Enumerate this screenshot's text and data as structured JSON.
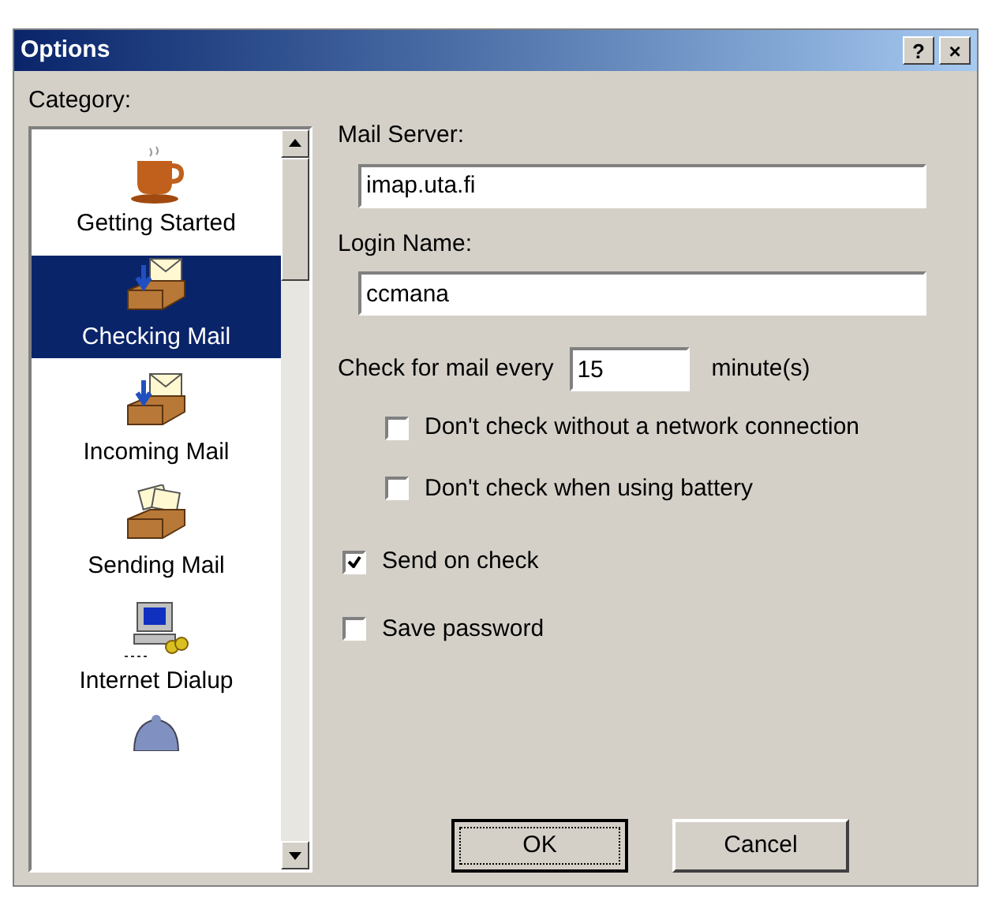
{
  "window": {
    "title": "Options",
    "title_buttons": [
      "?",
      "×"
    ]
  },
  "category": {
    "label": "Category:",
    "items": [
      {
        "kind": "cup",
        "label": "Getting Started",
        "selected": false
      },
      {
        "kind": "inbox",
        "label": "Checking Mail",
        "selected": true
      },
      {
        "kind": "inbox",
        "label": "Incoming Mail",
        "selected": false
      },
      {
        "kind": "outbox",
        "label": "Sending Mail",
        "selected": false
      },
      {
        "kind": "computer",
        "label": "Internet Dialup",
        "selected": false
      },
      {
        "kind": "person",
        "selected": false
      }
    ]
  },
  "fields": [
    {
      "label": "Mail Server:",
      "value": "imap.uta.fi"
    },
    {
      "label": "Login Name:",
      "value": "ccmana"
    }
  ],
  "check_interval": {
    "label": "Check for mail every",
    "value": "15",
    "unit": "minute(s)",
    "sub_options": [
      {
        "label": "Don't check without a network connection",
        "checked": false
      },
      {
        "label": "Don't check when using battery",
        "checked": false
      }
    ]
  },
  "options": [
    {
      "label": "Send on check",
      "checked": true
    },
    {
      "label": "Save password",
      "checked": false
    }
  ],
  "buttons": [
    "OK",
    "Cancel"
  ]
}
